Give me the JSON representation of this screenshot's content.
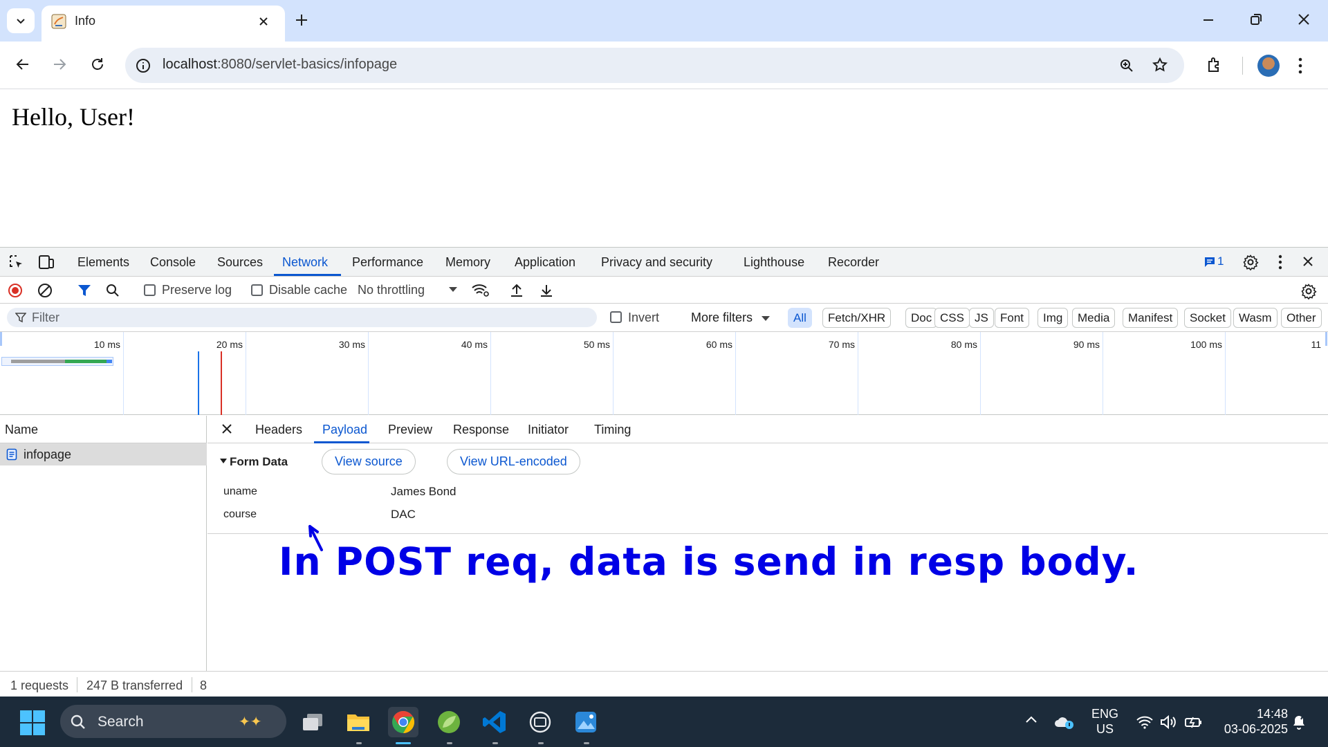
{
  "browser": {
    "tab_title": "Info",
    "url_host": "localhost",
    "url_rest": ":8080/servlet-basics/infopage"
  },
  "page": {
    "heading": "Hello, User!"
  },
  "devtools": {
    "tabs": [
      "Elements",
      "Console",
      "Sources",
      "Network",
      "Performance",
      "Memory",
      "Application",
      "Privacy and security",
      "Lighthouse",
      "Recorder"
    ],
    "active_tab": "Network",
    "issues_count": "1",
    "network_toolbar": {
      "preserve_log": "Preserve log",
      "disable_cache": "Disable cache",
      "throttling": "No throttling"
    },
    "filter": {
      "placeholder": "Filter",
      "invert": "Invert",
      "more_filters": "More filters",
      "types": [
        "All",
        "Fetch/XHR",
        "Doc",
        "CSS",
        "JS",
        "Font",
        "Img",
        "Media",
        "Manifest",
        "Socket",
        "Wasm",
        "Other"
      ],
      "active_type": "All"
    },
    "overview_ticks": [
      "10 ms",
      "20 ms",
      "30 ms",
      "40 ms",
      "50 ms",
      "60 ms",
      "70 ms",
      "80 ms",
      "90 ms",
      "100 ms",
      "11"
    ],
    "name_header": "Name",
    "requests": [
      {
        "name": "infopage"
      }
    ],
    "detail_tabs": [
      "Headers",
      "Payload",
      "Preview",
      "Response",
      "Initiator",
      "Timing"
    ],
    "active_detail_tab": "Payload",
    "form_data": {
      "title": "Form Data",
      "view_source": "View source",
      "view_url_encoded": "View URL-encoded",
      "fields": [
        {
          "key": "uname",
          "value": "James Bond"
        },
        {
          "key": "course",
          "value": "DAC"
        }
      ]
    },
    "status": {
      "requests": "1 requests",
      "transferred": "247 B transferred",
      "extra": "8"
    }
  },
  "annotation": "In POST req, data is send in resp body.",
  "taskbar": {
    "search_label": "Search",
    "lang_line1": "ENG",
    "lang_line2": "US",
    "time": "14:48",
    "date": "03-06-2025"
  },
  "colors": {
    "accent": "#0b57d0",
    "annotation": "#0000e6",
    "taskbar": "#1c2b3a"
  }
}
